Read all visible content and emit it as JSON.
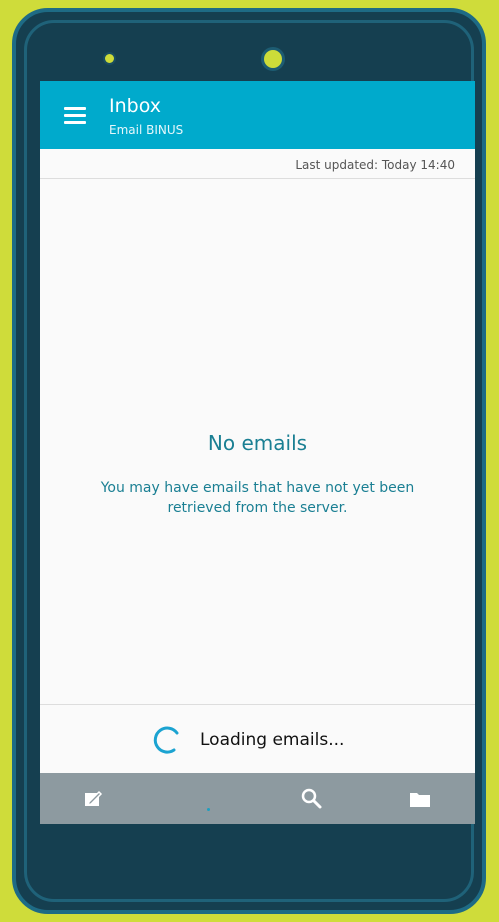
{
  "app_bar": {
    "title": "Inbox",
    "subtitle": "Email BINUS",
    "menu_icon": "hamburger-menu-icon"
  },
  "status": {
    "last_updated": "Last updated: Today 14:40"
  },
  "empty_state": {
    "title": "No emails",
    "description": "You may have emails that have not yet been retrieved from the server."
  },
  "loading": {
    "text": "Loading emails..."
  },
  "bottom_nav": {
    "items": [
      {
        "icon": "compose-icon"
      },
      {
        "icon": "search-icon"
      },
      {
        "icon": "folder-icon"
      }
    ]
  },
  "colors": {
    "app_bar": "#00aacc",
    "accent_text": "#1a7f93",
    "bottom_bar": "#8d9aa0",
    "device_body": "#153f50",
    "background": "#cfdc3a"
  }
}
